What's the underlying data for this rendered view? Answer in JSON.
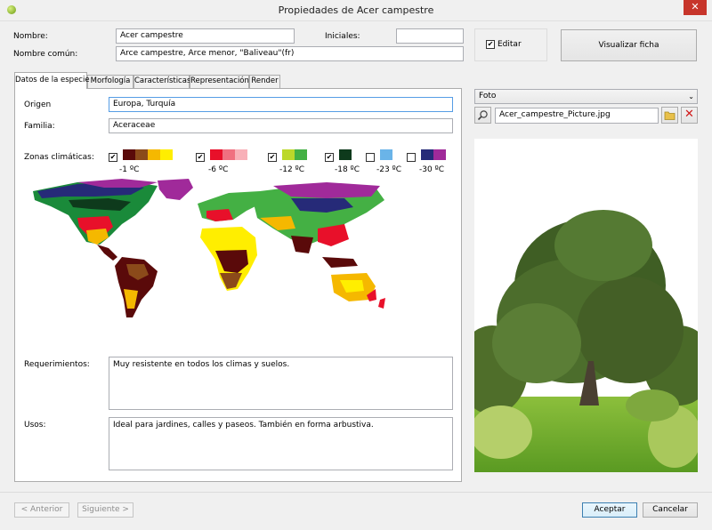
{
  "window": {
    "title": "Propiedades de Acer campestre"
  },
  "header": {
    "nombre_label": "Nombre:",
    "nombre_value": "Acer campestre",
    "comun_label": "Nombre común:",
    "comun_value": "Arce campestre, Arce menor, \"Baliveau\"(fr)",
    "iniciales_label": "Iniciales:",
    "iniciales_value": "",
    "editar_label": "Editar",
    "editar_checked": true,
    "visualizar_label": "Visualizar ficha"
  },
  "tabs": [
    {
      "label": "Datos de la especie",
      "active": true
    },
    {
      "label": "Morfología",
      "active": false
    },
    {
      "label": "Características",
      "active": false
    },
    {
      "label": "Representación",
      "active": false
    },
    {
      "label": "Render",
      "active": false
    }
  ],
  "form": {
    "origen_label": "Origen",
    "origen_value": "Europa, Turquía",
    "familia_label": "Familia:",
    "familia_value": "Aceraceae",
    "zonas_label": "Zonas climáticas:",
    "zonas": [
      {
        "label": "-1 ºC",
        "checked": true,
        "colors": [
          "#5a0a0a",
          "#8b4a1a",
          "#f5b800",
          "#ffee00"
        ]
      },
      {
        "label": "-6 ºC",
        "checked": true,
        "colors": [
          "#e8102a",
          "#f07080",
          "#f8b0b8"
        ]
      },
      {
        "label": "-12 ºC",
        "checked": true,
        "colors": [
          "#bcd82a",
          "#44b044"
        ]
      },
      {
        "label": "-18 ºC",
        "checked": true,
        "colors": [
          "#0e3a1c"
        ]
      },
      {
        "label": "-23 ºC",
        "checked": false,
        "colors": [
          "#6ab4e8"
        ]
      },
      {
        "label": "-30 ºC",
        "checked": false,
        "colors": [
          "#262a78",
          "#a02a9a"
        ]
      }
    ],
    "requerimientos_label": "Requerimientos:",
    "requerimientos_value": "Muy resistente en todos los climas y suelos.",
    "usos_label": "Usos:",
    "usos_value": "Ideal para jardines, calles y paseos. También en forma arbustiva."
  },
  "photo": {
    "select_value": "Foto",
    "file_value": "Acer_campestre_Picture.jpg"
  },
  "footer": {
    "anterior_label": "< Anterior",
    "siguiente_label": "Siguiente >",
    "aceptar_label": "Aceptar",
    "cancelar_label": "Cancelar"
  }
}
